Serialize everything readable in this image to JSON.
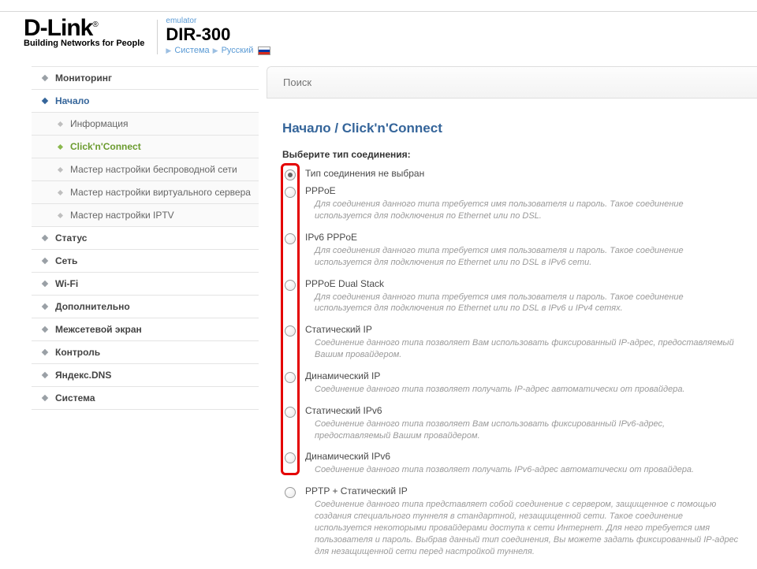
{
  "header": {
    "logo": "D-Link",
    "reg": "®",
    "tagline": "Building Networks for People",
    "emulator": "emulator",
    "device": "DIR-300",
    "crumb_system": "Система",
    "crumb_lang": "Русский"
  },
  "sidebar": {
    "items": [
      {
        "label": "Мониторинг",
        "active": false
      },
      {
        "label": "Начало",
        "active": true
      },
      {
        "label": "Статус",
        "active": false
      },
      {
        "label": "Сеть",
        "active": false
      },
      {
        "label": "Wi-Fi",
        "active": false
      },
      {
        "label": "Дополнительно",
        "active": false
      },
      {
        "label": "Межсетевой экран",
        "active": false
      },
      {
        "label": "Контроль",
        "active": false
      },
      {
        "label": "Яндекс.DNS",
        "active": false
      },
      {
        "label": "Система",
        "active": false
      }
    ],
    "submenu": [
      {
        "label": "Информация",
        "selected": false
      },
      {
        "label": "Click'n'Connect",
        "selected": true
      },
      {
        "label": "Мастер настройки беспроводной сети",
        "selected": false
      },
      {
        "label": "Мастер настройки виртуального сервера",
        "selected": false
      },
      {
        "label": "Мастер настройки IPTV",
        "selected": false
      }
    ]
  },
  "search": {
    "placeholder": "Поиск"
  },
  "page": {
    "title": "Начало /  Click'n'Connect",
    "section_label": "Выберите тип соединения:"
  },
  "options": [
    {
      "label": "Тип соединения не выбран",
      "desc": "",
      "checked": true
    },
    {
      "label": "PPPoE",
      "desc": "Для соединения данного типа требуется имя пользователя и пароль. Такое соединение используется для подключения по Ethernet или по DSL."
    },
    {
      "label": "IPv6 PPPoE",
      "desc": "Для соединения данного типа требуется имя пользователя и пароль. Такое соединение используется для подключения по Ethernet или по DSL в IPv6 сети."
    },
    {
      "label": "PPPoE Dual Stack",
      "desc": "Для соединения данного типа требуется имя пользователя и пароль. Такое соединение используется для подключения по Ethernet или по DSL в IPv6 и IPv4 сетях."
    },
    {
      "label": "Статический IP",
      "desc": "Соединение данного типа позволяет Вам использовать фиксированный IP-адрес, предоставляемый Вашим провайдером."
    },
    {
      "label": "Динамический IP",
      "desc": "Соединение данного типа позволяет получать IP-адрес автоматически от провайдера."
    },
    {
      "label": "Статический IPv6",
      "desc": "Соединение данного типа позволяет Вам использовать фиксированный IPv6-адрес, предоставляемый Вашим провайдером."
    },
    {
      "label": "Динамический IPv6",
      "desc": "Соединение данного типа позволяет получать IPv6-адрес автоматически от провайдера."
    },
    {
      "label": "PPTP + Статический IP",
      "desc": "Соединение данного типа представляет собой соединение с сервером, защищенное с помощью создания специального туннеля в стандартной, незащищенной сети. Такое соединение используется некоторыми провайдерами доступа к сети Интернет. Для него требуется имя пользователя и пароль. Выбрав данный тип соединения, Вы можете задать фиксированный IP-адрес для незащищенной сети перед настройкой туннеля."
    }
  ]
}
